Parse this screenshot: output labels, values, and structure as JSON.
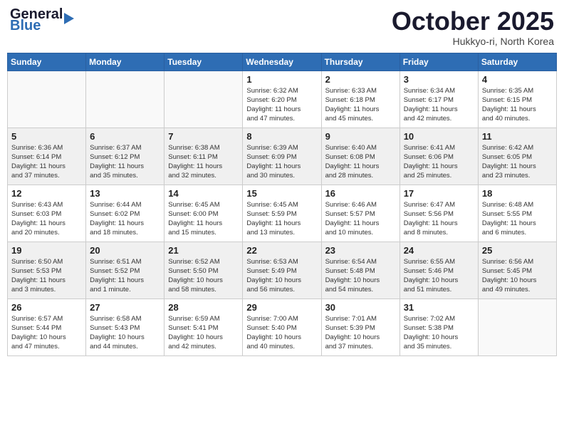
{
  "header": {
    "logo_text_general": "General",
    "logo_text_blue": "Blue",
    "month_title": "October 2025",
    "location": "Hukkyo-ri, North Korea"
  },
  "weekdays": [
    "Sunday",
    "Monday",
    "Tuesday",
    "Wednesday",
    "Thursday",
    "Friday",
    "Saturday"
  ],
  "weeks": [
    {
      "shaded": false,
      "days": [
        {
          "num": "",
          "info": ""
        },
        {
          "num": "",
          "info": ""
        },
        {
          "num": "",
          "info": ""
        },
        {
          "num": "1",
          "info": "Sunrise: 6:32 AM\nSunset: 6:20 PM\nDaylight: 11 hours\nand 47 minutes."
        },
        {
          "num": "2",
          "info": "Sunrise: 6:33 AM\nSunset: 6:18 PM\nDaylight: 11 hours\nand 45 minutes."
        },
        {
          "num": "3",
          "info": "Sunrise: 6:34 AM\nSunset: 6:17 PM\nDaylight: 11 hours\nand 42 minutes."
        },
        {
          "num": "4",
          "info": "Sunrise: 6:35 AM\nSunset: 6:15 PM\nDaylight: 11 hours\nand 40 minutes."
        }
      ]
    },
    {
      "shaded": true,
      "days": [
        {
          "num": "5",
          "info": "Sunrise: 6:36 AM\nSunset: 6:14 PM\nDaylight: 11 hours\nand 37 minutes."
        },
        {
          "num": "6",
          "info": "Sunrise: 6:37 AM\nSunset: 6:12 PM\nDaylight: 11 hours\nand 35 minutes."
        },
        {
          "num": "7",
          "info": "Sunrise: 6:38 AM\nSunset: 6:11 PM\nDaylight: 11 hours\nand 32 minutes."
        },
        {
          "num": "8",
          "info": "Sunrise: 6:39 AM\nSunset: 6:09 PM\nDaylight: 11 hours\nand 30 minutes."
        },
        {
          "num": "9",
          "info": "Sunrise: 6:40 AM\nSunset: 6:08 PM\nDaylight: 11 hours\nand 28 minutes."
        },
        {
          "num": "10",
          "info": "Sunrise: 6:41 AM\nSunset: 6:06 PM\nDaylight: 11 hours\nand 25 minutes."
        },
        {
          "num": "11",
          "info": "Sunrise: 6:42 AM\nSunset: 6:05 PM\nDaylight: 11 hours\nand 23 minutes."
        }
      ]
    },
    {
      "shaded": false,
      "days": [
        {
          "num": "12",
          "info": "Sunrise: 6:43 AM\nSunset: 6:03 PM\nDaylight: 11 hours\nand 20 minutes."
        },
        {
          "num": "13",
          "info": "Sunrise: 6:44 AM\nSunset: 6:02 PM\nDaylight: 11 hours\nand 18 minutes."
        },
        {
          "num": "14",
          "info": "Sunrise: 6:45 AM\nSunset: 6:00 PM\nDaylight: 11 hours\nand 15 minutes."
        },
        {
          "num": "15",
          "info": "Sunrise: 6:45 AM\nSunset: 5:59 PM\nDaylight: 11 hours\nand 13 minutes."
        },
        {
          "num": "16",
          "info": "Sunrise: 6:46 AM\nSunset: 5:57 PM\nDaylight: 11 hours\nand 10 minutes."
        },
        {
          "num": "17",
          "info": "Sunrise: 6:47 AM\nSunset: 5:56 PM\nDaylight: 11 hours\nand 8 minutes."
        },
        {
          "num": "18",
          "info": "Sunrise: 6:48 AM\nSunset: 5:55 PM\nDaylight: 11 hours\nand 6 minutes."
        }
      ]
    },
    {
      "shaded": true,
      "days": [
        {
          "num": "19",
          "info": "Sunrise: 6:50 AM\nSunset: 5:53 PM\nDaylight: 11 hours\nand 3 minutes."
        },
        {
          "num": "20",
          "info": "Sunrise: 6:51 AM\nSunset: 5:52 PM\nDaylight: 11 hours\nand 1 minute."
        },
        {
          "num": "21",
          "info": "Sunrise: 6:52 AM\nSunset: 5:50 PM\nDaylight: 10 hours\nand 58 minutes."
        },
        {
          "num": "22",
          "info": "Sunrise: 6:53 AM\nSunset: 5:49 PM\nDaylight: 10 hours\nand 56 minutes."
        },
        {
          "num": "23",
          "info": "Sunrise: 6:54 AM\nSunset: 5:48 PM\nDaylight: 10 hours\nand 54 minutes."
        },
        {
          "num": "24",
          "info": "Sunrise: 6:55 AM\nSunset: 5:46 PM\nDaylight: 10 hours\nand 51 minutes."
        },
        {
          "num": "25",
          "info": "Sunrise: 6:56 AM\nSunset: 5:45 PM\nDaylight: 10 hours\nand 49 minutes."
        }
      ]
    },
    {
      "shaded": false,
      "days": [
        {
          "num": "26",
          "info": "Sunrise: 6:57 AM\nSunset: 5:44 PM\nDaylight: 10 hours\nand 47 minutes."
        },
        {
          "num": "27",
          "info": "Sunrise: 6:58 AM\nSunset: 5:43 PM\nDaylight: 10 hours\nand 44 minutes."
        },
        {
          "num": "28",
          "info": "Sunrise: 6:59 AM\nSunset: 5:41 PM\nDaylight: 10 hours\nand 42 minutes."
        },
        {
          "num": "29",
          "info": "Sunrise: 7:00 AM\nSunset: 5:40 PM\nDaylight: 10 hours\nand 40 minutes."
        },
        {
          "num": "30",
          "info": "Sunrise: 7:01 AM\nSunset: 5:39 PM\nDaylight: 10 hours\nand 37 minutes."
        },
        {
          "num": "31",
          "info": "Sunrise: 7:02 AM\nSunset: 5:38 PM\nDaylight: 10 hours\nand 35 minutes."
        },
        {
          "num": "",
          "info": ""
        }
      ]
    }
  ]
}
